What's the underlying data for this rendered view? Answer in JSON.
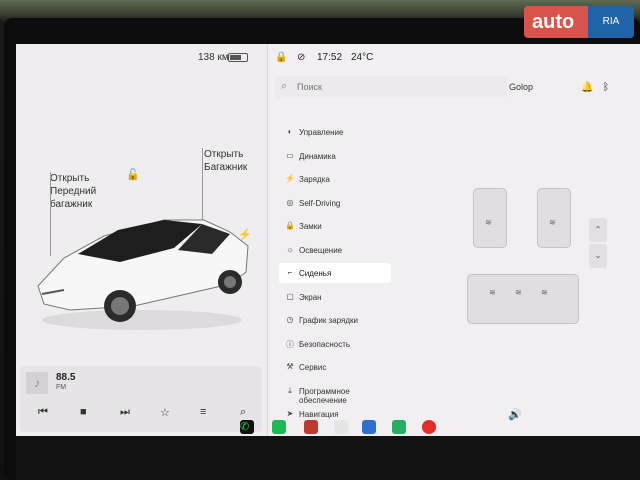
{
  "status": {
    "range": "138 км",
    "time": "17:52",
    "temperature": "24°C",
    "user": "Golop"
  },
  "car_panel": {
    "front_trunk_label": "Открыть\nПередний\nбагажник",
    "trunk_label": "Открыть\nБагажник"
  },
  "search": {
    "placeholder": "Поиск"
  },
  "menu": {
    "items": [
      {
        "label": "Управление",
        "icon": "toggle-icon"
      },
      {
        "label": "Динамика",
        "icon": "car-icon"
      },
      {
        "label": "Зарядка",
        "icon": "bolt-icon"
      },
      {
        "label": "Self-Driving",
        "icon": "steering-icon"
      },
      {
        "label": "Замки",
        "icon": "lock-icon"
      },
      {
        "label": "Освещение",
        "icon": "sun-icon"
      },
      {
        "label": "Сиденья",
        "icon": "seat-icon",
        "active": true
      },
      {
        "label": "Экран",
        "icon": "screen-icon"
      },
      {
        "label": "График зарядки",
        "icon": "clock-icon"
      },
      {
        "label": "Безопасность",
        "icon": "info-icon"
      },
      {
        "label": "Сервис",
        "icon": "wrench-icon"
      },
      {
        "label": "Программное\nобеспечение",
        "icon": "download-icon"
      },
      {
        "label": "Навигация",
        "icon": "nav-icon"
      }
    ]
  },
  "media": {
    "station": "88.5",
    "band": "FM"
  },
  "watermark": {
    "brand": "auto",
    "brand_suffix": "RIA"
  },
  "colors": {
    "accent": "#d9534a",
    "ria_blue": "#1f63a8",
    "screen_bg": "#f1eff1"
  }
}
